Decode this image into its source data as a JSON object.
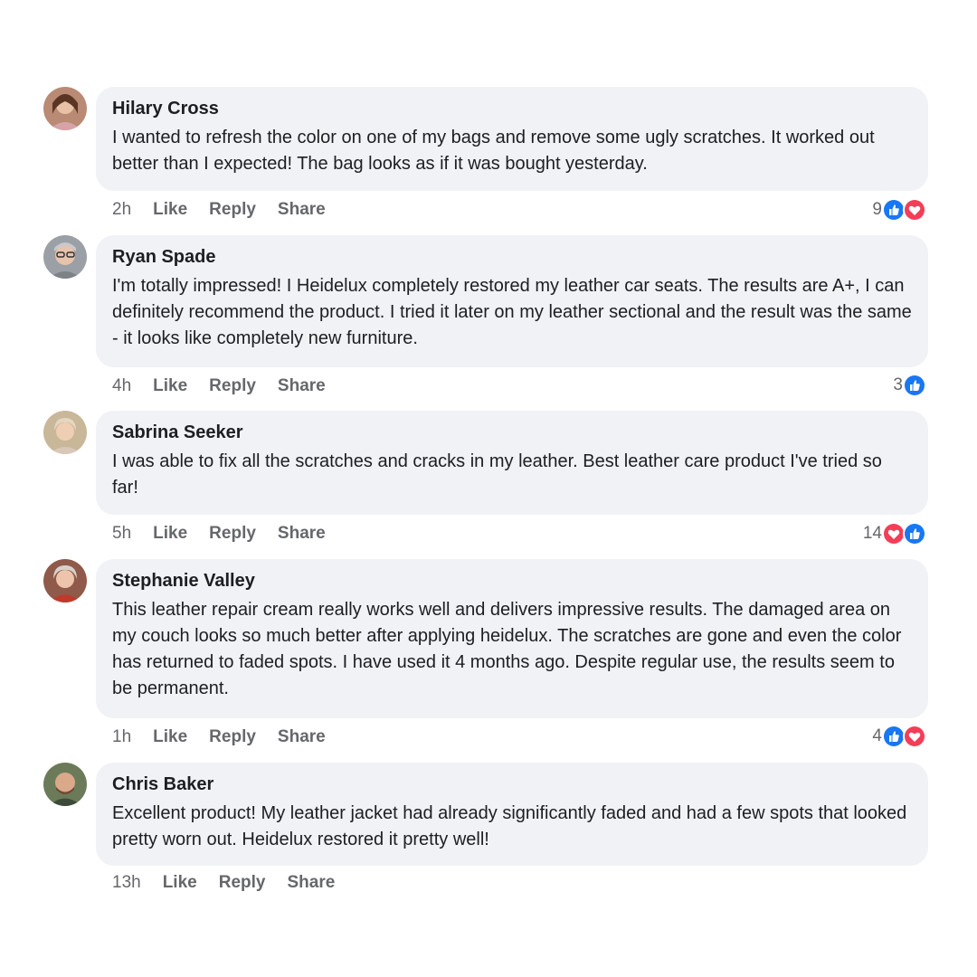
{
  "comments": [
    {
      "author": "Hilary Cross",
      "text": "I wanted to refresh the color on one of my bags and remove some ugly scratches. It worked out better than I expected! The bag looks as if it was bought yesterday.",
      "time": "2h",
      "actions": {
        "like": "Like",
        "reply": "Reply",
        "share": "Share"
      },
      "reaction_count": "9",
      "reactions": [
        "like-icon",
        "love-icon"
      ]
    },
    {
      "author": "Ryan Spade",
      "text": "I'm totally impressed! I Heidelux completely restored my leather car seats. The results are A+, I can definitely recommend the product. I tried it later on my leather sectional and the result was the same - it looks like completely new furniture.",
      "time": "4h",
      "actions": {
        "like": "Like",
        "reply": "Reply",
        "share": "Share"
      },
      "reaction_count": "3",
      "reactions": [
        "like-icon"
      ]
    },
    {
      "author": "Sabrina Seeker",
      "text": "I was able to fix all the scratches and cracks in my leather. Best leather care product I've tried so far!",
      "time": "5h",
      "actions": {
        "like": "Like",
        "reply": "Reply",
        "share": "Share"
      },
      "reaction_count": "14",
      "reactions": [
        "love-icon",
        "like-icon"
      ]
    },
    {
      "author": "Stephanie Valley",
      "text": "This leather repair cream really works well and delivers impressive results. The damaged area on my couch looks so much better after applying heidelux. The scratches are gone and even the color has returned to faded spots. I have used it 4 months ago. Despite regular use, the results seem to be permanent.",
      "time": "1h",
      "actions": {
        "like": "Like",
        "reply": "Reply",
        "share": "Share"
      },
      "reaction_count": "4",
      "reactions": [
        "like-icon",
        "love-icon"
      ]
    },
    {
      "author": "Chris Baker",
      "text": "Excellent product! My leather jacket had already significantly faded and had a few spots that looked pretty worn out. Heidelux restored it pretty well!",
      "time": "13h",
      "actions": {
        "like": "Like",
        "reply": "Reply",
        "share": "Share"
      },
      "reaction_count": "",
      "reactions": []
    }
  ],
  "colors": {
    "bubble": "#f0f2f5",
    "like": "#1877f2",
    "love": "#f33e58",
    "meta": "#65676b"
  }
}
